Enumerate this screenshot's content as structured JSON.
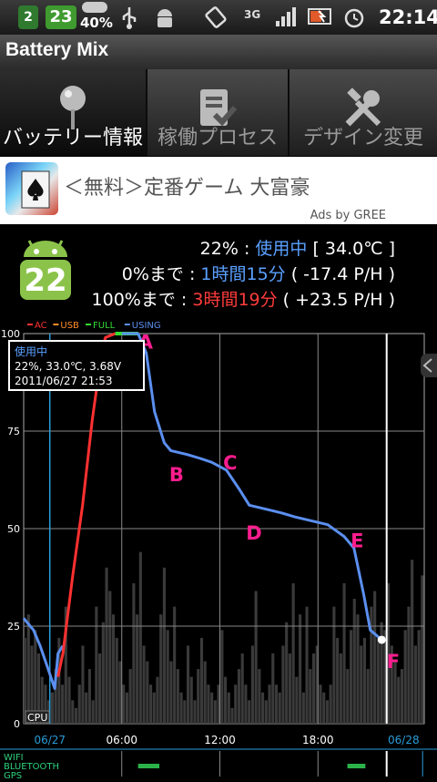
{
  "status_bar": {
    "badge_small": "2",
    "badge_large": "23",
    "battery_pct": "40%",
    "network": "3G",
    "time": "22:14"
  },
  "app": {
    "title": "Battery Mix"
  },
  "tabs": [
    {
      "label": "バッテリー情報",
      "icon": "pin-icon",
      "selected": true
    },
    {
      "label": "稼働プロセス",
      "icon": "checklist-icon",
      "selected": false
    },
    {
      "label": "デザイン変更",
      "icon": "tools-icon",
      "selected": false
    }
  ],
  "ad": {
    "text": "＜無料＞定番ゲーム 大富豪",
    "by": "Ads by GREE"
  },
  "battery": {
    "level_badge": "22",
    "line1_pct": "22%",
    "line1_sep": ":",
    "line1_state": "使用中",
    "line1_temp": "[ 34.0℃ ]",
    "line2_label": "0%まで",
    "line2_sep": ":",
    "line2_time": "1時間15分",
    "line2_rate": "( -17.4 P/H )",
    "line3_label": "100%まで",
    "line3_sep": ":",
    "line3_time": "3時間19分",
    "line3_rate": "( +23.5 P/H )"
  },
  "chart_data": {
    "type": "line",
    "legend": [
      {
        "name": "AC",
        "color": "#ff3030"
      },
      {
        "name": "USB",
        "color": "#ff8c2a"
      },
      {
        "name": "FULL",
        "color": "#33dd33"
      },
      {
        "name": "USING",
        "color": "#5b8ff0"
      }
    ],
    "y_ticks": [
      "0",
      "25",
      "50",
      "75",
      "100"
    ],
    "ylim": [
      0,
      100
    ],
    "x_ticks": [
      "06/27",
      "06:00",
      "12:00",
      "18:00",
      "06/28"
    ],
    "cpu_label": "CPU",
    "tooltip": {
      "line1": "使用中",
      "line2": "22%, 33.0℃, 3.68V",
      "line3": "2011/06/27 21:53"
    },
    "series_using_before": [
      [
        0.0,
        27
      ],
      [
        0.6,
        24
      ],
      [
        1.0,
        20
      ],
      [
        1.5,
        14
      ],
      [
        1.9,
        9
      ],
      [
        2.1,
        18
      ],
      [
        2.4,
        20
      ]
    ],
    "series_ac": [
      [
        2.1,
        12
      ],
      [
        2.4,
        18
      ],
      [
        3.0,
        38
      ],
      [
        3.6,
        56
      ],
      [
        4.2,
        78
      ],
      [
        4.8,
        96
      ],
      [
        5.0,
        99
      ],
      [
        5.6,
        100
      ]
    ],
    "series_using": [
      [
        6.0,
        100
      ],
      [
        7.0,
        100
      ],
      [
        7.5,
        95
      ],
      [
        8.0,
        80
      ],
      [
        8.6,
        72
      ],
      [
        9.0,
        70
      ],
      [
        10.0,
        69
      ],
      [
        10.8,
        68
      ],
      [
        11.5,
        67
      ],
      [
        12.4,
        65
      ],
      [
        13.2,
        60
      ],
      [
        13.8,
        56
      ],
      [
        14.8,
        55
      ],
      [
        15.8,
        54
      ],
      [
        16.6,
        53
      ],
      [
        17.6,
        52
      ],
      [
        18.6,
        51
      ],
      [
        19.6,
        48
      ],
      [
        20.2,
        45
      ],
      [
        20.8,
        33
      ],
      [
        21.2,
        24
      ],
      [
        21.9,
        21.5
      ]
    ],
    "series_full": [
      [
        5.6,
        100
      ],
      [
        7.0,
        100
      ]
    ],
    "points": [
      {
        "label": "A",
        "x": 7.0,
        "y": 99
      },
      {
        "label": "B",
        "x": 8.9,
        "y": 65
      },
      {
        "label": "C",
        "x": 12.2,
        "y": 68
      },
      {
        "label": "D",
        "x": 13.6,
        "y": 50
      },
      {
        "label": "E",
        "x": 20.0,
        "y": 48
      },
      {
        "label": "F",
        "x": 22.2,
        "y": 17
      }
    ],
    "cpu_bars": [
      22,
      28,
      20,
      24,
      18,
      12,
      10,
      6,
      8,
      14,
      22,
      10,
      30,
      12,
      6,
      4,
      10,
      20,
      8,
      14,
      6,
      30,
      18,
      26,
      40,
      34,
      28,
      22,
      16,
      10,
      8,
      14,
      36,
      28,
      44,
      20,
      16,
      10,
      8,
      12,
      28,
      40,
      24,
      16,
      30,
      14,
      8,
      6,
      20,
      12,
      6,
      14,
      22,
      16,
      10,
      8,
      6,
      10,
      24,
      12,
      8,
      4,
      10,
      14,
      18,
      10,
      6,
      20,
      34,
      14,
      8,
      6,
      10,
      18,
      10,
      8,
      20,
      26,
      18,
      36,
      12,
      28,
      8,
      30,
      14,
      18,
      20,
      10,
      8,
      6,
      10,
      30,
      22,
      18,
      36,
      14,
      24,
      32,
      28,
      20,
      22,
      14,
      30,
      34,
      22,
      26,
      24,
      36,
      20,
      16,
      12,
      14,
      24,
      30,
      42,
      20,
      24,
      38
    ],
    "tracks": [
      {
        "name": "WIFI",
        "spans": []
      },
      {
        "name": "BLUETOOTH",
        "spans": [
          [
            7.0,
            8.3
          ],
          [
            19.8,
            20.9
          ]
        ]
      },
      {
        "name": "GPS",
        "spans": []
      }
    ]
  }
}
